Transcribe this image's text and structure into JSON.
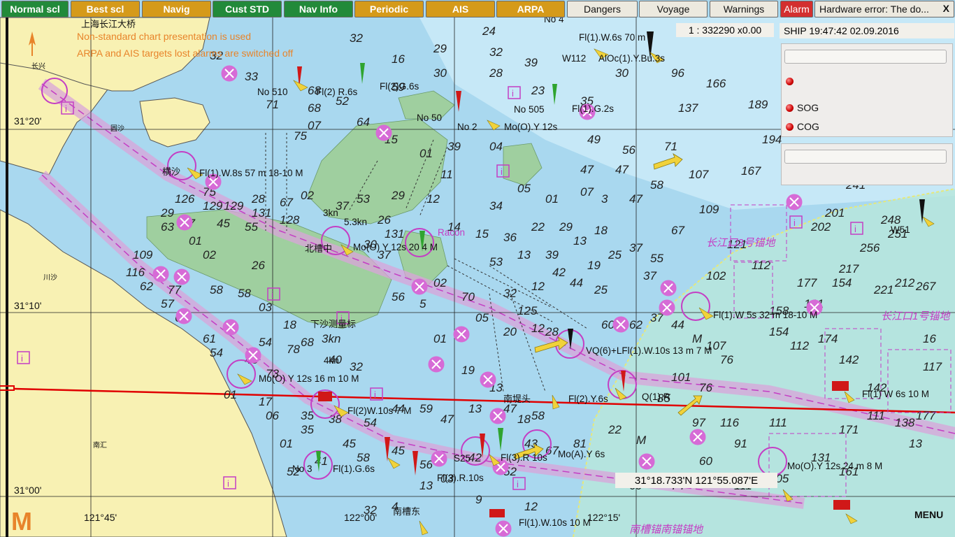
{
  "toolbar": {
    "buttons": [
      {
        "label": "Normal scl",
        "style": "green"
      },
      {
        "label": "Best scl",
        "style": "orange"
      },
      {
        "label": "Navig",
        "style": "orange"
      },
      {
        "label": "Cust STD",
        "style": "green"
      },
      {
        "label": "Nav Info",
        "style": "green"
      },
      {
        "label": "Periodic",
        "style": "orange"
      },
      {
        "label": "AIS",
        "style": "orange"
      },
      {
        "label": "ARPA",
        "style": "orange"
      },
      {
        "label": "Dangers",
        "style": "light"
      },
      {
        "label": "Voyage",
        "style": "light"
      },
      {
        "label": "Warnings",
        "style": "light"
      },
      {
        "label": "Alarm",
        "style": "red"
      }
    ],
    "error_message": "Hardware error: The do...",
    "close_symbol": "X"
  },
  "status": {
    "scale": "1 : 332290  x0.00",
    "ship_time": "SHIP  19:47:42  02.09.2016",
    "cursor_position": "31°18.733'N 121°55.087'E",
    "menu": "MENU"
  },
  "side_panel": {
    "sog_label": "SOG",
    "cog_label": "COG"
  },
  "warnings": {
    "line1": "Non-standard chart presentation is used",
    "line2": "ARPA and AIS targets lost alarms are switched off"
  },
  "chart": {
    "lat_labels": [
      "31°20'",
      "31°10'",
      "31°00'"
    ],
    "lon_labels": [
      "121°45'",
      "122°00'",
      "122°15'"
    ],
    "place_labels": [
      "上海长江大桥",
      "北槽中",
      "下沙测量标",
      "南槽东",
      "南堤头",
      "长江口3号锚地",
      "长江口1号锚地",
      "南槽锚南锚锚地",
      "长兴",
      "横沙",
      "圆沙",
      "川沙",
      "南汇"
    ],
    "light_labels": [
      "Fl(1).W.8s 57 m 18-10 M",
      "Fl(2)G.6s",
      "Fl(2) R.6s",
      "Mo(O).Y 12s",
      "Fl(1).G.2s",
      "Fl(1).W.6s 70 m",
      "AlOc(1).Y.Bu.3s",
      "Mo(O) Y 12s 20 4 M",
      "VQ(6)+LFl(1).W.10s 13 m 7 M",
      "Fl(2).Y.6s",
      "Q(1).R",
      "Fl(1).W 5s 32 m 18-10 M",
      "Fl(1) W 6s 10 M",
      "Mo(O) Y 12s 16 m 10 M",
      "Fl(2)W.10s 7 M",
      "Fl(3).R 10s",
      "Mo(A).Y 6s",
      "Fl(1).G.6s",
      "Fl(3).R.10s",
      "Mo(O).Y 12s 24 m 8 M",
      "Fl(1).W.10s 10 M",
      "No 2",
      "No 3",
      "No 4",
      "No 50",
      "No 505",
      "No 510",
      "W112",
      "W51",
      "S25",
      "Racon",
      "3kn",
      "5.3kn",
      "4kn"
    ]
  },
  "colors": {
    "land": "#f8f1b3",
    "shallow": "#a9d8ef",
    "deep": "#c9e9f8",
    "drying": "#9fcf9f",
    "magenta": "#c43ec4",
    "route": "#e00000",
    "warning_text": "#e8842a"
  }
}
